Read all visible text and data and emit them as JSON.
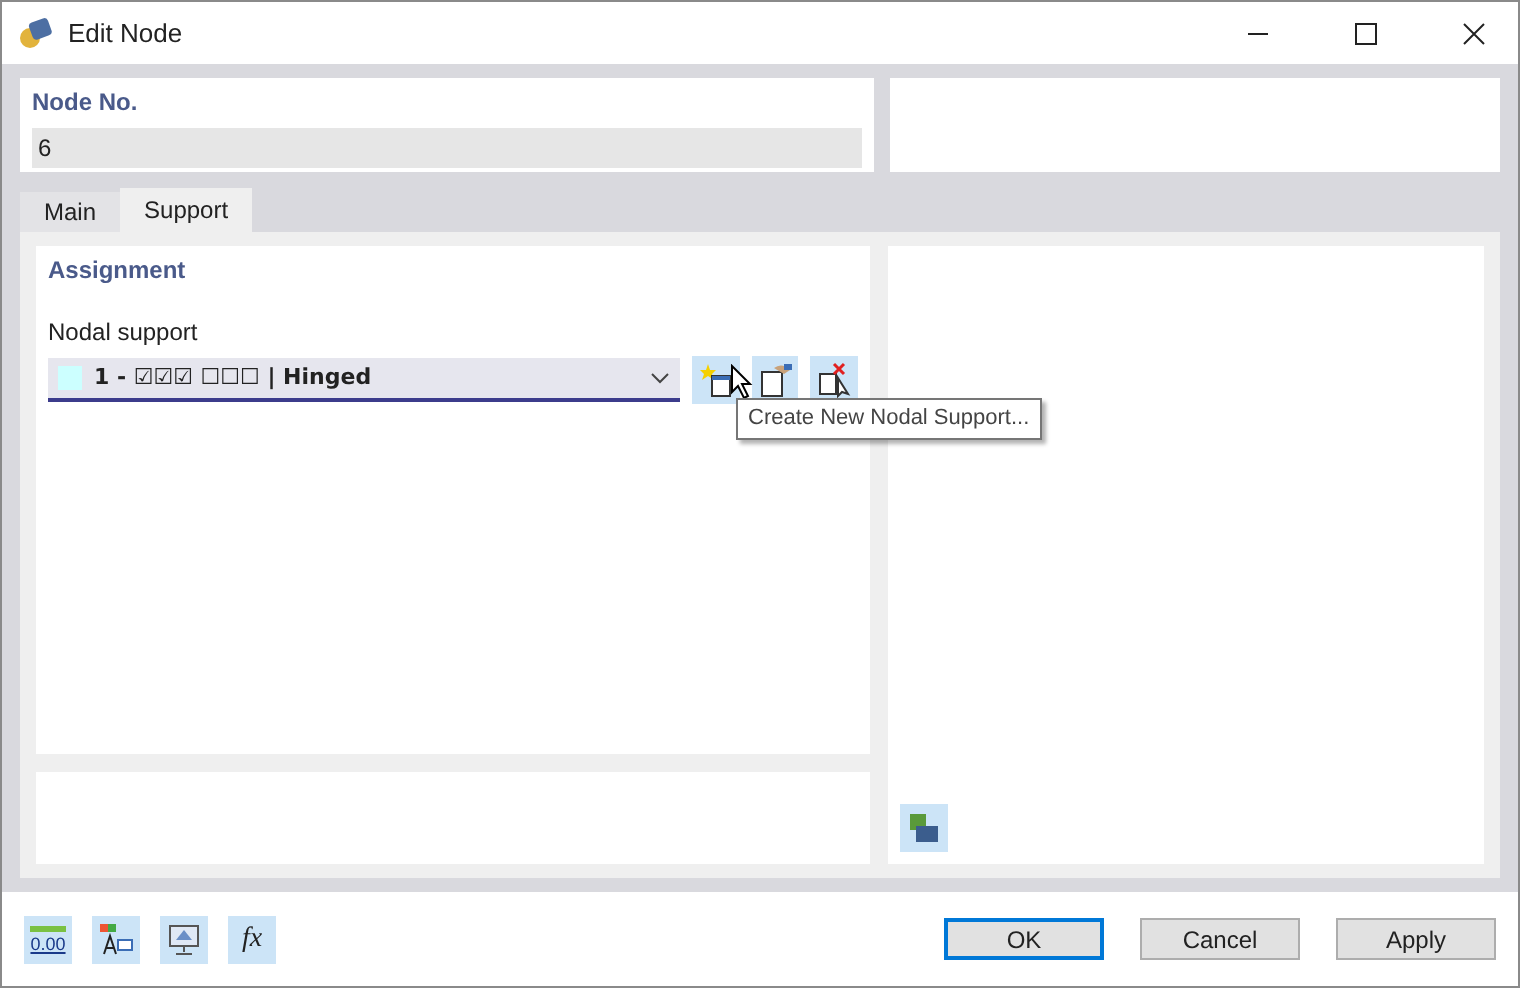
{
  "window": {
    "title": "Edit Node"
  },
  "node": {
    "label": "Node No.",
    "value": "6"
  },
  "tabs": [
    {
      "label": "Main",
      "selected": false
    },
    {
      "label": "Support",
      "selected": true
    }
  ],
  "assignment": {
    "title": "Assignment",
    "field_label": "Nodal support",
    "value": "1 - ☑☑☑ ☐☐☐ | Hinged",
    "color": "#ccffff"
  },
  "tooltip": "Create New Nodal Support...",
  "footer_tools": [
    {
      "kind": "units",
      "label": "0.00"
    },
    {
      "kind": "text"
    },
    {
      "kind": "view"
    },
    {
      "kind": "formula",
      "label": "fx"
    }
  ],
  "buttons": [
    {
      "label": "OK",
      "default": true
    },
    {
      "label": "Cancel",
      "default": false
    },
    {
      "label": "Apply",
      "default": false
    }
  ]
}
